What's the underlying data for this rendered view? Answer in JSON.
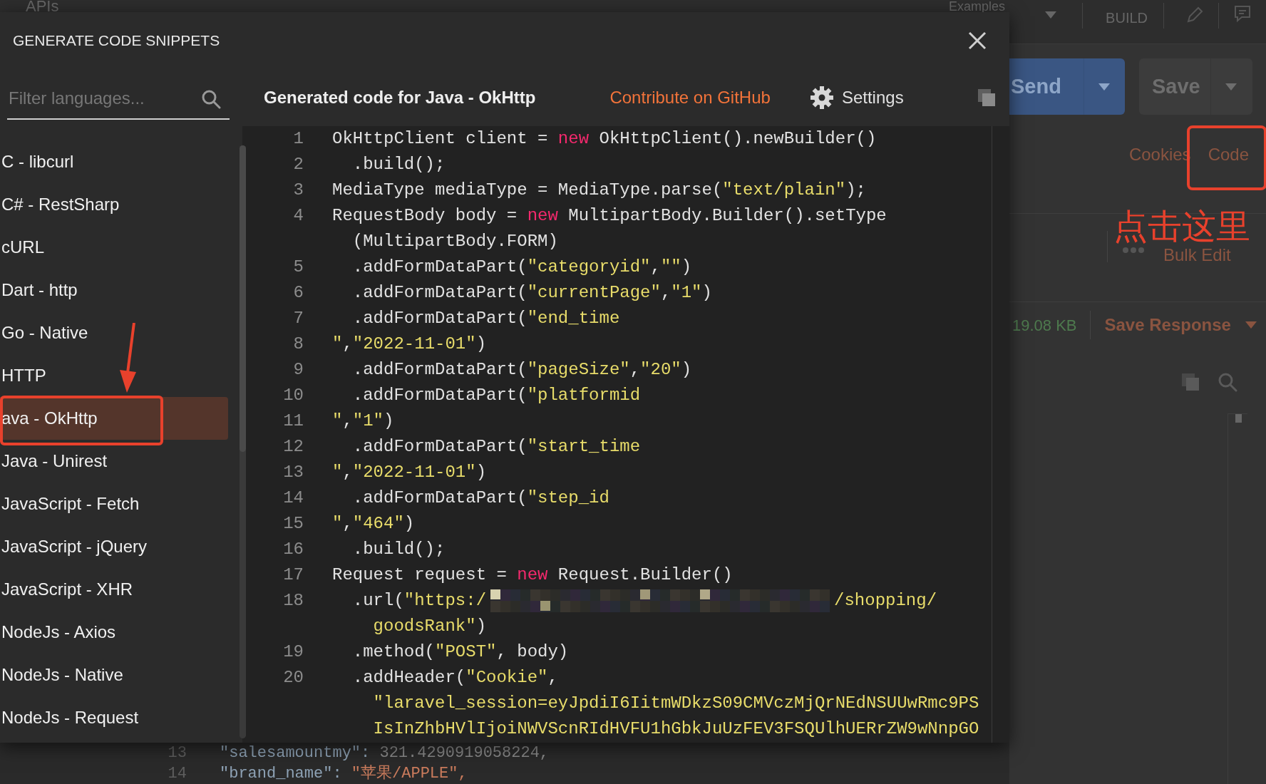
{
  "app_bar": {
    "section": "APIs",
    "examples": "Examples",
    "build": "BUILD"
  },
  "request": {
    "send": "Send",
    "save": "Save",
    "links": [
      "Cookies",
      "Code"
    ],
    "bulk_edit": "Bulk Edit",
    "size": "19.08 KB",
    "save_response": "Save Response"
  },
  "background_editor": [
    {
      "number": "13",
      "segments": [
        {
          "kind": "key",
          "text": "\"salesamountmy\": "
        },
        {
          "kind": "number",
          "text": "321.4290919058224,"
        }
      ]
    },
    {
      "number": "14",
      "segments": [
        {
          "kind": "key",
          "text": "\"brand_name\": "
        },
        {
          "kind": "string",
          "text": "\"苹果/APPLE\","
        }
      ]
    }
  ],
  "modal": {
    "title": "GENERATE CODE SNIPPETS",
    "filter": {
      "placeholder": "Filter languages..."
    },
    "languages": [
      {
        "label": "C - libcurl",
        "selected": false
      },
      {
        "label": "C# - RestSharp",
        "selected": false
      },
      {
        "label": "cURL",
        "selected": false
      },
      {
        "label": "Dart - http",
        "selected": false
      },
      {
        "label": "Go - Native",
        "selected": false
      },
      {
        "label": "HTTP",
        "selected": false
      },
      {
        "label": "ava - OkHttp",
        "selected": true
      },
      {
        "label": "Java - Unirest",
        "selected": false
      },
      {
        "label": "JavaScript - Fetch",
        "selected": false
      },
      {
        "label": "JavaScript - jQuery",
        "selected": false
      },
      {
        "label": "JavaScript - XHR",
        "selected": false
      },
      {
        "label": "NodeJs - Axios",
        "selected": false
      },
      {
        "label": "NodeJs - Native",
        "selected": false
      },
      {
        "label": "NodeJs - Request",
        "selected": false
      }
    ],
    "code_title": "Generated code for Java - OkHttp",
    "contribute": "Contribute on GitHub",
    "settings": "Settings",
    "code_lines": [
      {
        "number": "1",
        "segments": [
          {
            "kind": "plain",
            "text": "OkHttpClient client = "
          },
          {
            "kind": "keyword",
            "text": "new"
          },
          {
            "kind": "plain",
            "text": " OkHttpClient().newBuilder()"
          }
        ]
      },
      {
        "number": "2",
        "segments": [
          {
            "kind": "plain",
            "text": "  .build();"
          }
        ]
      },
      {
        "number": "3",
        "segments": [
          {
            "kind": "plain",
            "text": "MediaType mediaType = MediaType.parse("
          },
          {
            "kind": "string",
            "text": "\"text/plain\""
          },
          {
            "kind": "plain",
            "text": ");"
          }
        ]
      },
      {
        "number": "4",
        "segments": [
          {
            "kind": "plain",
            "text": "RequestBody body = "
          },
          {
            "kind": "keyword",
            "text": "new"
          },
          {
            "kind": "plain",
            "text": " MultipartBody.Builder().setType"
          }
        ]
      },
      {
        "segments": [
          {
            "kind": "plain",
            "text": "  (MultipartBody.FORM)"
          }
        ]
      },
      {
        "number": "5",
        "segments": [
          {
            "kind": "plain",
            "text": "  .addFormDataPart("
          },
          {
            "kind": "string",
            "text": "\"categoryid\""
          },
          {
            "kind": "plain",
            "text": ","
          },
          {
            "kind": "string",
            "text": "\"\""
          },
          {
            "kind": "plain",
            "text": ")"
          }
        ]
      },
      {
        "number": "6",
        "segments": [
          {
            "kind": "plain",
            "text": "  .addFormDataPart("
          },
          {
            "kind": "string",
            "text": "\"currentPage\""
          },
          {
            "kind": "plain",
            "text": ","
          },
          {
            "kind": "string",
            "text": "\"1\""
          },
          {
            "kind": "plain",
            "text": ")"
          }
        ]
      },
      {
        "number": "7",
        "segments": [
          {
            "kind": "plain",
            "text": "  .addFormDataPart("
          },
          {
            "kind": "string",
            "text": "\"end_time"
          }
        ]
      },
      {
        "number": "8",
        "segments": [
          {
            "kind": "string",
            "text": "\""
          },
          {
            "kind": "plain",
            "text": ","
          },
          {
            "kind": "string",
            "text": "\"2022-11-01\""
          },
          {
            "kind": "plain",
            "text": ")"
          }
        ]
      },
      {
        "number": "9",
        "segments": [
          {
            "kind": "plain",
            "text": "  .addFormDataPart("
          },
          {
            "kind": "string",
            "text": "\"pageSize\""
          },
          {
            "kind": "plain",
            "text": ","
          },
          {
            "kind": "string",
            "text": "\"20\""
          },
          {
            "kind": "plain",
            "text": ")"
          }
        ]
      },
      {
        "number": "10",
        "segments": [
          {
            "kind": "plain",
            "text": "  .addFormDataPart("
          },
          {
            "kind": "string",
            "text": "\"platformid"
          }
        ]
      },
      {
        "number": "11",
        "segments": [
          {
            "kind": "string",
            "text": "\""
          },
          {
            "kind": "plain",
            "text": ","
          },
          {
            "kind": "string",
            "text": "\"1\""
          },
          {
            "kind": "plain",
            "text": ")"
          }
        ]
      },
      {
        "number": "12",
        "segments": [
          {
            "kind": "plain",
            "text": "  .addFormDataPart("
          },
          {
            "kind": "string",
            "text": "\"start_time"
          }
        ]
      },
      {
        "number": "13",
        "segments": [
          {
            "kind": "string",
            "text": "\""
          },
          {
            "kind": "plain",
            "text": ","
          },
          {
            "kind": "string",
            "text": "\"2022-11-01\""
          },
          {
            "kind": "plain",
            "text": ")"
          }
        ]
      },
      {
        "number": "14",
        "segments": [
          {
            "kind": "plain",
            "text": "  .addFormDataPart("
          },
          {
            "kind": "string",
            "text": "\"step_id"
          }
        ]
      },
      {
        "number": "15",
        "segments": [
          {
            "kind": "string",
            "text": "\""
          },
          {
            "kind": "plain",
            "text": ","
          },
          {
            "kind": "string",
            "text": "\"464\""
          },
          {
            "kind": "plain",
            "text": ")"
          }
        ]
      },
      {
        "number": "16",
        "segments": [
          {
            "kind": "plain",
            "text": "  .build();"
          }
        ]
      },
      {
        "number": "17",
        "segments": [
          {
            "kind": "plain",
            "text": "Request request = "
          },
          {
            "kind": "keyword",
            "text": "new"
          },
          {
            "kind": "plain",
            "text": " Request.Builder()"
          }
        ]
      },
      {
        "number": "18",
        "segments": [
          {
            "kind": "plain",
            "text": "  .url("
          },
          {
            "kind": "string",
            "text": "\"https:/"
          },
          {
            "kind": "redacted"
          },
          {
            "kind": "string",
            "text": "/shopping/"
          }
        ]
      },
      {
        "segments": [
          {
            "kind": "string",
            "text": "    goodsRank\""
          },
          {
            "kind": "plain",
            "text": ")"
          }
        ]
      },
      {
        "number": "19",
        "segments": [
          {
            "kind": "plain",
            "text": "  .method("
          },
          {
            "kind": "string",
            "text": "\"POST\""
          },
          {
            "kind": "plain",
            "text": ", body)"
          }
        ]
      },
      {
        "number": "20",
        "segments": [
          {
            "kind": "plain",
            "text": "  .addHeader("
          },
          {
            "kind": "string",
            "text": "\"Cookie\""
          },
          {
            "kind": "plain",
            "text": ","
          }
        ]
      },
      {
        "segments": [
          {
            "kind": "string",
            "text": "    \"laravel_session=eyJpdiI6IitmWDkzS09CMVczMjQrNEdNSUUwRmc9PS"
          }
        ]
      },
      {
        "segments": [
          {
            "kind": "string",
            "text": "    IsInZhbHVlIjoiNWVScnRIdHVFU1hGbkJuUzFEV3FSQUlhUERrZW9wNnpGO"
          }
        ]
      }
    ]
  },
  "annotation": {
    "text": "点击这里"
  }
}
